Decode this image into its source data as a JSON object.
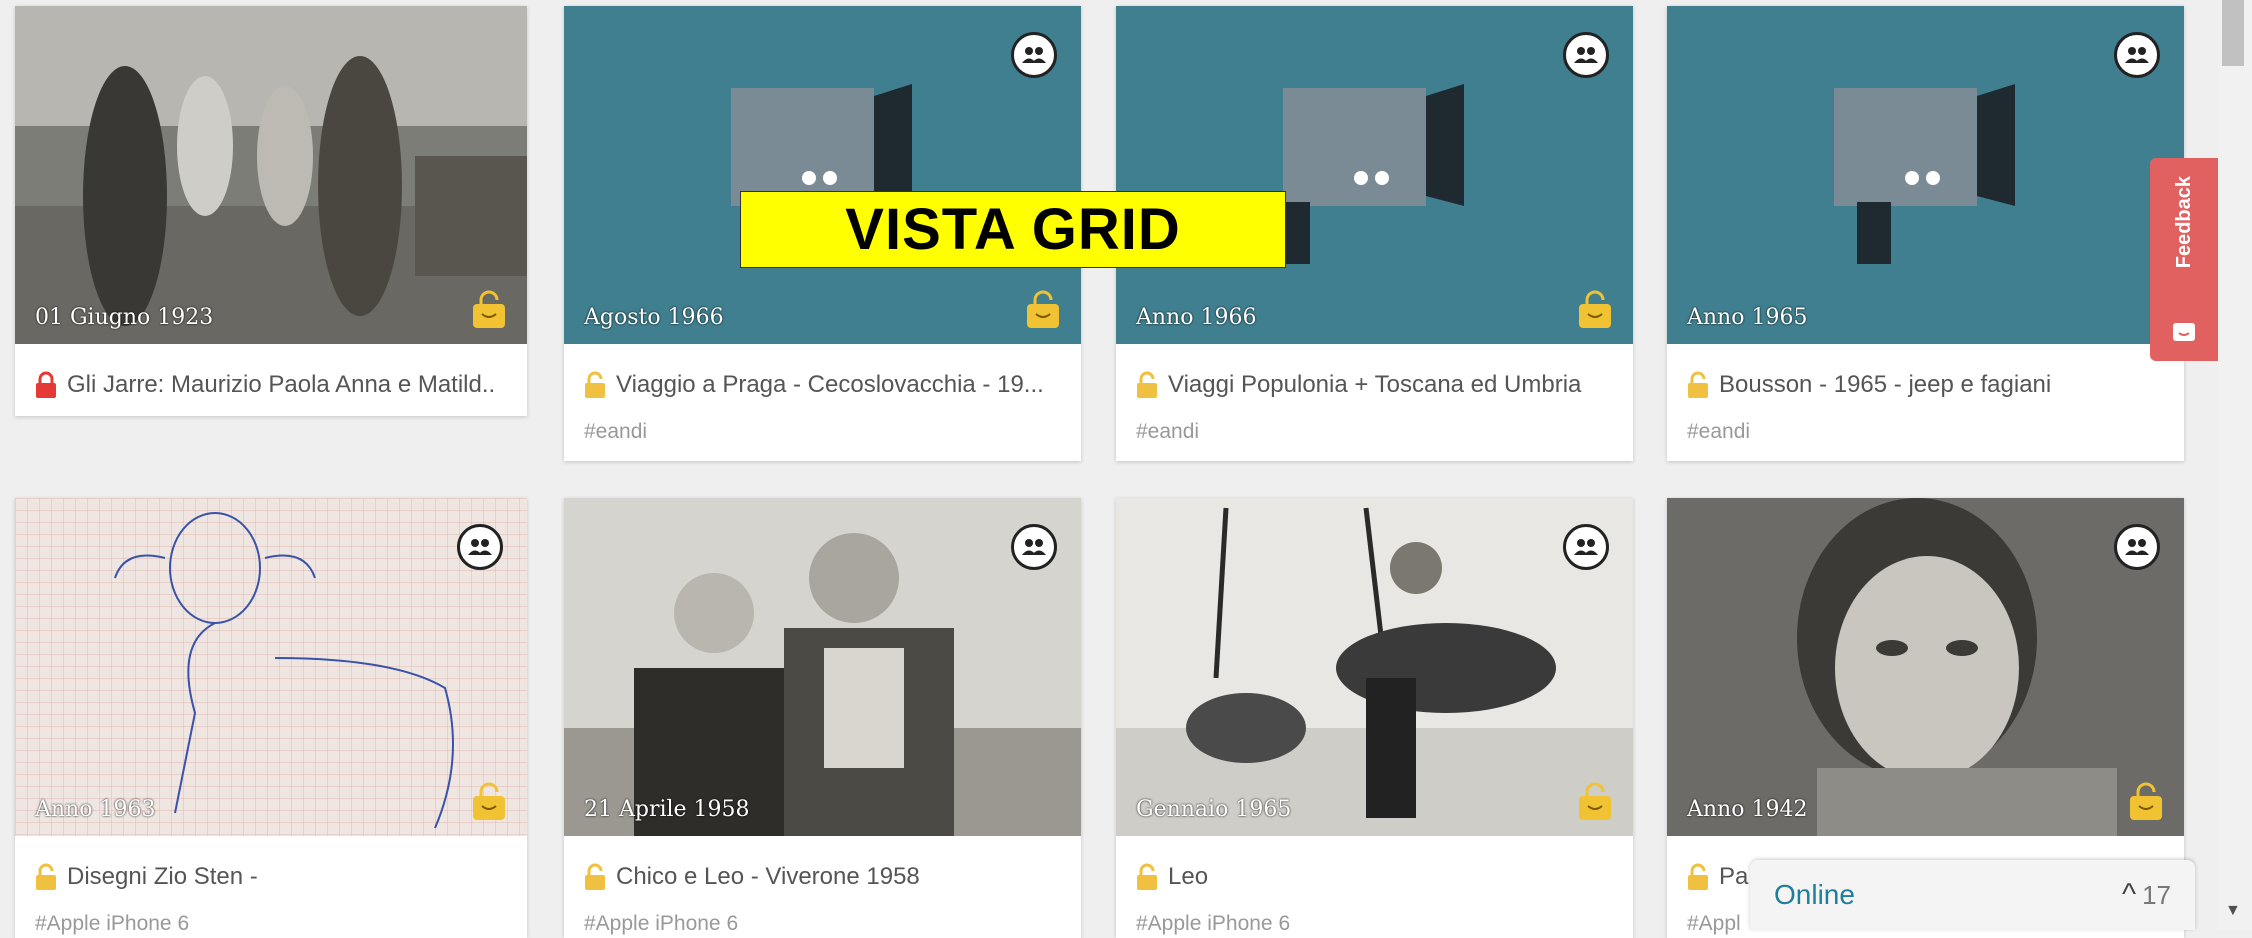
{
  "overlay": {
    "label": "VISTA GRID"
  },
  "feedback": {
    "label": "Feedback"
  },
  "chat": {
    "status": "Online",
    "toggle": "^",
    "count": "17"
  },
  "colors": {
    "teal": "#3f7f8f",
    "feedback": "#e0615f",
    "badge": "#f1c232",
    "lock_red": "#e53935",
    "lock_gold": "#f0c040"
  },
  "cards": [
    {
      "date": "01 Giugno 1923",
      "title": "Gli Jarre: Maurizio Paola Anna e Matild..",
      "tag": "",
      "lock": "closed-red"
    },
    {
      "date": "Agosto 1966",
      "title": "Viaggio a Praga - Cecoslovacchia - 19...",
      "tag": "#eandi",
      "lock": "open-gold"
    },
    {
      "date": "Anno 1966",
      "title": "Viaggi Populonia + Toscana ed Umbria",
      "tag": "#eandi",
      "lock": "open-gold"
    },
    {
      "date": "Anno 1965",
      "title": "Bousson - 1965 - jeep e fagiani",
      "tag": "#eandi",
      "lock": "open-gold"
    },
    {
      "date": "Anno 1963",
      "title": "Disegni Zio Sten -",
      "tag": "#Apple iPhone 6",
      "lock": "open-gold"
    },
    {
      "date": "21 Aprile 1958",
      "title": "Chico e Leo - Viverone 1958",
      "tag": "#Apple iPhone 6",
      "lock": "open-gold"
    },
    {
      "date": "Gennaio 1965",
      "title": "Leo",
      "tag": "#Apple iPhone 6",
      "lock": "open-gold"
    },
    {
      "date": "Anno 1942",
      "title": "Pa",
      "tag": "#Appl",
      "lock": "open-gold"
    }
  ]
}
